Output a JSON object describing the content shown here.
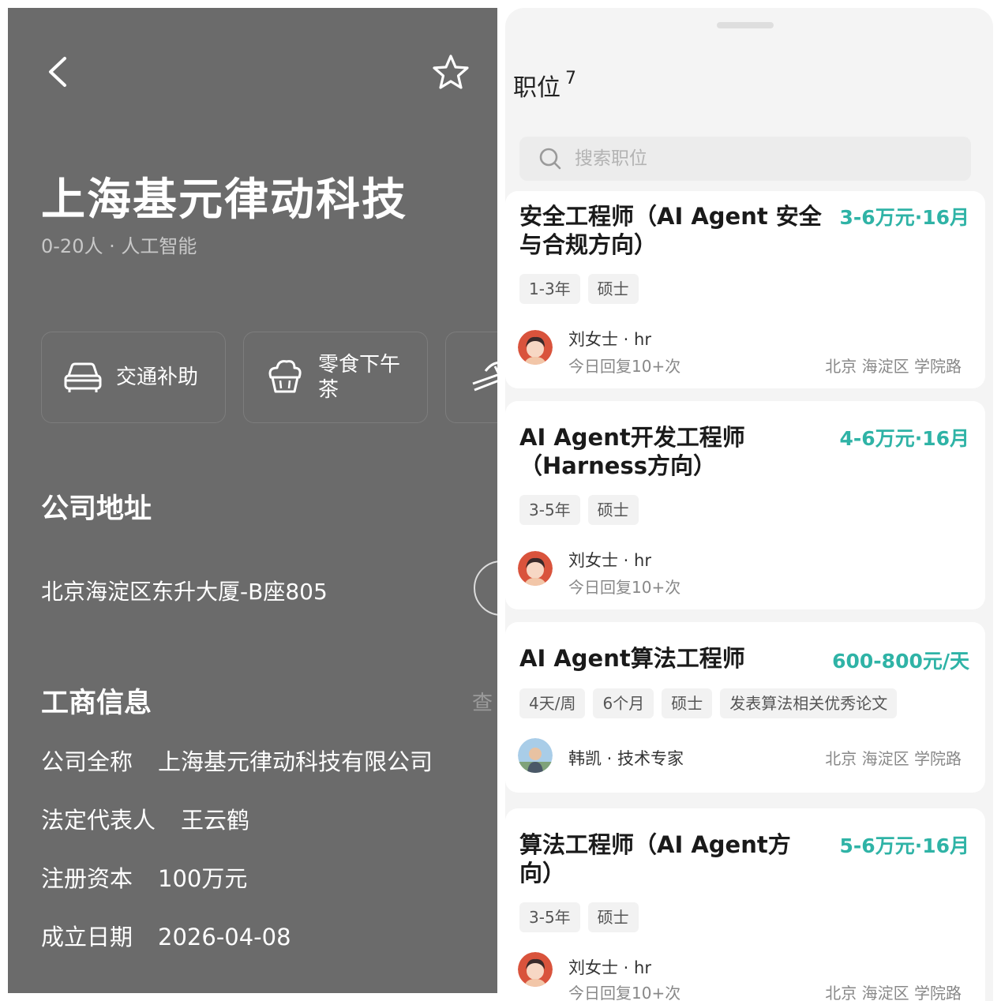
{
  "company": {
    "name": "上海基元律动科技",
    "meta": "0-20人 · 人工智能"
  },
  "benefits": [
    {
      "label": "交通补助",
      "icon": "car-icon"
    },
    {
      "label": "零食下午茶",
      "icon": "cupcake-icon"
    },
    {
      "label": "",
      "icon": "lounge-chair-icon"
    }
  ],
  "address": {
    "title": "公司地址",
    "text": "北京海淀区东升大厦-B座805"
  },
  "business_info": {
    "title": "工商信息",
    "more": "查",
    "rows": [
      {
        "label": "公司全称",
        "value": "上海基元律动科技有限公司"
      },
      {
        "label": "法定代表人",
        "value": "王云鹤"
      },
      {
        "label": "注册资本",
        "value": "100万元"
      },
      {
        "label": "成立日期",
        "value": "2026-04-08"
      }
    ]
  },
  "positions": {
    "title": "职位",
    "count": "7",
    "search_placeholder": "搜索职位",
    "jobs": [
      {
        "title_line1": "安全工程师（AI Agent 安全",
        "title_line2": "与合规方向）",
        "salary": "3-6万元·16月",
        "tags": [
          "1-3年",
          "硕士"
        ],
        "hr": "刘女士 · hr",
        "reply": "今日回复10+次",
        "location": "北京  海淀区  学院路"
      },
      {
        "title_line1": "AI Agent开发工程师",
        "title_line2": "（Harness方向）",
        "salary": "4-6万元·16月",
        "tags": [
          "3-5年",
          "硕士"
        ],
        "hr": "刘女士 · hr",
        "reply": "今日回复10+次",
        "location": ""
      },
      {
        "title_line1": "AI Agent算法工程师",
        "title_line2": "",
        "salary": "600-800元/天",
        "tags": [
          "4天/周",
          "6个月",
          "硕士",
          "发表算法相关优秀论文"
        ],
        "hr": "韩凯 · 技术专家",
        "reply": "",
        "location": "北京  海淀区  学院路"
      },
      {
        "title_line1": "算法工程师（AI Agent方",
        "title_line2": "向）",
        "salary": "5-6万元·16月",
        "tags": [
          "3-5年",
          "硕士"
        ],
        "hr": "刘女士 · hr",
        "reply": "今日回复10+次",
        "location": "北京  海淀区  学院路"
      }
    ]
  },
  "colors": {
    "salary": "#2fb3a6",
    "left_bg": "#6b6b6b"
  }
}
